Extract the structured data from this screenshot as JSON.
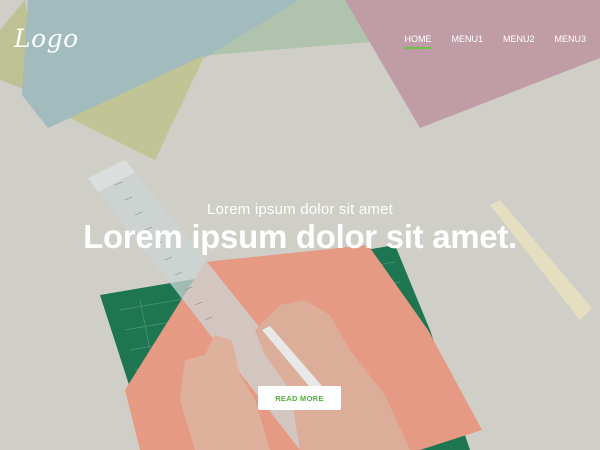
{
  "brand": {
    "logo_text": "Logo"
  },
  "nav": {
    "items": [
      {
        "label": "HOME",
        "active": true
      },
      {
        "label": "MENU1",
        "active": false
      },
      {
        "label": "MENU2",
        "active": false
      },
      {
        "label": "MENU3",
        "active": false
      }
    ]
  },
  "hero": {
    "subtitle": "Lorem ipsum dolor sit amet",
    "headline": "Lorem ipsum dolor sit amet.",
    "cta_label": "READ MORE"
  },
  "colors": {
    "accent": "#6cc24a",
    "cta_text": "#4fae3a",
    "background": "#d9d8d2",
    "paper_blue": "#a9c3c4",
    "paper_yellow": "#c9cd9c",
    "paper_green": "#b8cbb3",
    "paper_pink": "#c8a4ad",
    "paper_peach": "#f0a089",
    "cutting_mat": "#1f7a55"
  }
}
